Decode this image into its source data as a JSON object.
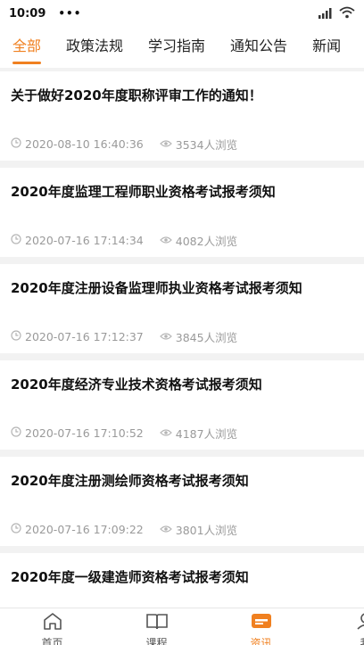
{
  "status_bar": {
    "time": "10:09",
    "dots": "•••"
  },
  "tabs": [
    {
      "label": "全部",
      "active": true
    },
    {
      "label": "政策法规",
      "active": false
    },
    {
      "label": "学习指南",
      "active": false
    },
    {
      "label": "通知公告",
      "active": false
    },
    {
      "label": "新闻",
      "active": false
    }
  ],
  "articles": [
    {
      "title": "关于做好2020年度职称评审工作的通知！",
      "time": "2020-08-10 16:40:36",
      "views": "3534人浏览"
    },
    {
      "title": "2020年度监理工程师职业资格考试报考须知",
      "time": "2020-07-16 17:14:34",
      "views": "4082人浏览"
    },
    {
      "title": "2020年度注册设备监理师执业资格考试报考须知",
      "time": "2020-07-16 17:12:37",
      "views": "3845人浏览"
    },
    {
      "title": "2020年度经济专业技术资格考试报考须知",
      "time": "2020-07-16 17:10:52",
      "views": "4187人浏览"
    },
    {
      "title": "2020年度注册测绘师资格考试报考须知",
      "time": "2020-07-16 17:09:22",
      "views": "3801人浏览"
    },
    {
      "title": "2020年度一级建造师资格考试报考须知",
      "time": "",
      "views": ""
    }
  ],
  "bottom_nav": [
    {
      "label": "首页",
      "icon": "home-icon",
      "active": false
    },
    {
      "label": "课程",
      "icon": "book-icon",
      "active": false
    },
    {
      "label": "资讯",
      "icon": "news-icon",
      "active": true
    },
    {
      "label": "我",
      "icon": "profile-icon",
      "active": false
    }
  ],
  "colors": {
    "accent": "#f08020",
    "meta_text": "#9a9a9a"
  }
}
